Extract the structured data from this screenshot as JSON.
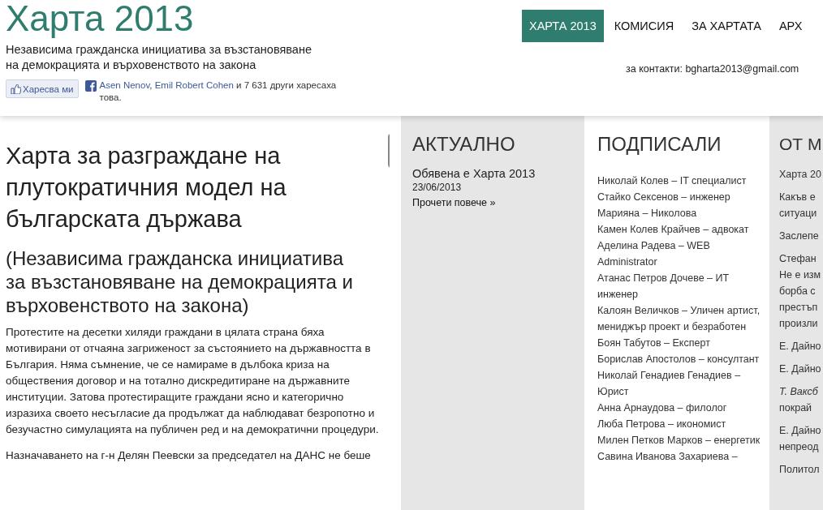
{
  "site": {
    "title": "Харта 2013",
    "tagline_lines": [
      "Независима гражданска инициатива за възстановяване",
      "на демокрацията и върховенството на закона"
    ],
    "like_button": "Харесва ми",
    "likes": [
      {
        "text": "Asen Nenov",
        "link": true
      },
      {
        "text": ", ",
        "link": false
      },
      {
        "text": "Emil Robert Cohen",
        "link": true
      },
      {
        "text": " и 7 631 други харесаха това.",
        "link": false
      }
    ],
    "contact": "за контакти: bgharta2013@gmail.com"
  },
  "nav": [
    {
      "label": "ХАРТА 2013",
      "selected": true
    },
    {
      "label": "КОМИСИЯ",
      "selected": false
    },
    {
      "label": "ЗА ХАРТАТА",
      "selected": false
    },
    {
      "label": "АРХ",
      "selected": false
    }
  ],
  "article": {
    "title": "Харта за разграждане на плутократичния модел на българската държава",
    "subtitle": "(Независима гражданска инициатива за възстановяване на демокрацията и върховенството на закона)",
    "paragraphs": [
      "Протестите на десетки хиляди граждани в цялата страна бяха мотивирани от отчаяна загриженост за състоянието на държавността в България. Няма съмнение, че се намираме в дълбока криза на обществения договор и на тотално дискредитиране на държавните институции. Затова протестиращите граждани ясно и категорично изразиха своето несъгласие да продължат да наблюдават безропотно и безучастно симулацията на публичен ред и на демократични процедури.",
      "Назначаването на г-н Делян Пеевски за председател на ДАНС не беше"
    ]
  },
  "news": {
    "heading": "АКТУАЛНО",
    "items": [
      {
        "title": "Обявена е Харта 2013",
        "date": "23/06/2013",
        "more": "Прочети повече »"
      }
    ]
  },
  "signatories": {
    "heading": "ПОДПИСАЛИ",
    "items": [
      "Николай Колев – IT специалист",
      "Стайко Сексенов – инженер",
      "Марияна – Николова",
      "Камен Колев Крайчев – адвокат",
      "Аделина Радева – WEB Administrator",
      "Атанас Петров Дочеве – ИТ инженер",
      "Калоян Величков – Уличен артист, мениджър проект и безработен",
      "Боян Табутов – Експерт",
      "Борислав Апостолов – консултант",
      "Николай Генадиев Генадиев – Юрист",
      "Анна Арнаудова – филолог",
      "Люба Петрова – икономист",
      "Милен Петков Марков – енергетик",
      "Савина Иванова Захариева –"
    ]
  },
  "media": {
    "heading": "ОТ М",
    "items": [
      [
        "Харта 20"
      ],
      [
        "Какъв е",
        "ситуаци"
      ],
      [
        "Заслепе"
      ],
      [
        "Стефан",
        "Не е изм",
        "борба с",
        "престъп",
        "произли"
      ],
      [
        "Е. Дайно"
      ],
      [
        "Е. Дайно"
      ],
      [
        "*Т. Ваксб*",
        "покрай"
      ],
      [
        "Е. Дайно",
        "непреод"
      ],
      [
        "Политол"
      ]
    ]
  }
}
